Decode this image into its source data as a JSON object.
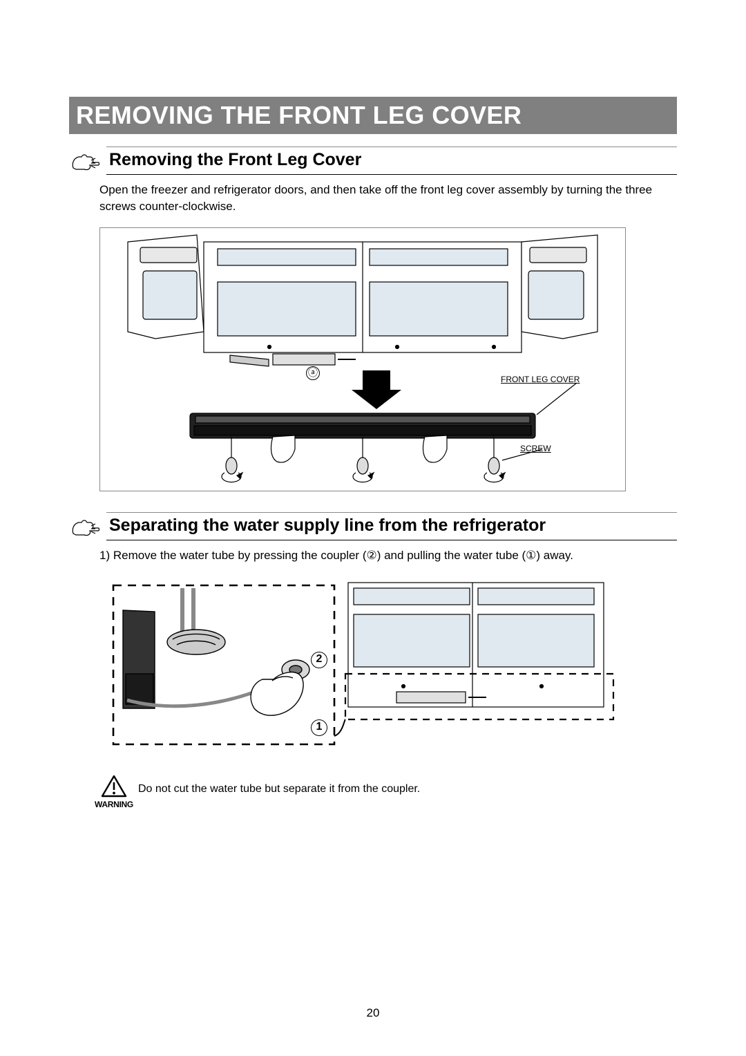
{
  "page": {
    "number": "20",
    "title": "REMOVING THE FRONT LEG COVER"
  },
  "section1": {
    "heading": "Removing the Front Leg Cover",
    "body": "Open the freezer and refrigerator doors, and then take off the front leg cover assembly by turning the three screws counter-clockwise.",
    "figure": {
      "label_a": "ⓐ",
      "label_front_leg_cover": "FRONT LEG COVER",
      "label_screw": "SCREW"
    }
  },
  "section2": {
    "heading": "Separating the water supply line from the refrigerator",
    "step": "1) Remove the water tube by pressing the coupler (②) and pulling the water tube (①) away.",
    "callout1": "1",
    "callout2": "2"
  },
  "warning": {
    "label": "WARNING",
    "text": "Do not cut the water tube but separate it from the coupler."
  }
}
